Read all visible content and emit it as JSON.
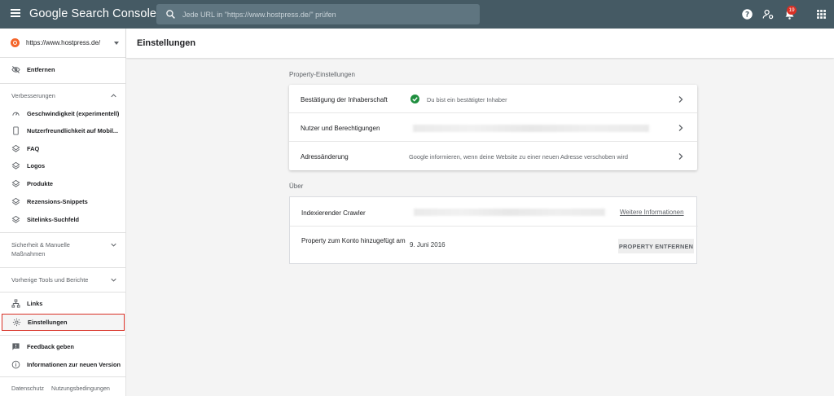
{
  "app": {
    "title": "Google Search Console"
  },
  "search": {
    "placeholder": "Jede URL in \"https://www.hostpress.de/\" prüfen"
  },
  "topbar": {
    "notification_count": "19"
  },
  "sidebar": {
    "property": "https://www.hostpress.de/",
    "remove_item": "Entfernen",
    "sections": {
      "improvements": "Verbesserungen",
      "security": "Sicherheit & Manuelle Maßnahmen",
      "legacy": "Vorherige Tools und Berichte"
    },
    "improvement_items": [
      {
        "label": "Geschwindigkeit (experimentell)",
        "icon": "speed-icon"
      },
      {
        "label": "Nutzerfreundlichkeit auf Mobil...",
        "icon": "mobile-icon"
      },
      {
        "label": "FAQ",
        "icon": "layers-icon"
      },
      {
        "label": "Logos",
        "icon": "layers-icon"
      },
      {
        "label": "Produkte",
        "icon": "layers-icon"
      },
      {
        "label": "Rezensions-Snippets",
        "icon": "layers-icon"
      },
      {
        "label": "Sitelinks-Suchfeld",
        "icon": "layers-icon"
      }
    ],
    "links": "Links",
    "settings": "Einstellungen",
    "feedback": "Feedback geben",
    "new_version": "Informationen zur neuen Version",
    "footer": {
      "privacy": "Datenschutz",
      "terms": "Nutzungsbedingungen"
    }
  },
  "main": {
    "title": "Einstellungen",
    "property_settings": {
      "heading": "Property-Einstellungen",
      "rows": [
        {
          "label": "Bestätigung der Inhaberschaft",
          "value": "Du bist ein bestätigter Inhaber"
        },
        {
          "label": "Nutzer und Berechtigungen",
          "value": ""
        },
        {
          "label": "Adressänderung",
          "value": "Google informieren, wenn deine Website zu einer neuen Adresse verschoben wird"
        }
      ]
    },
    "about": {
      "heading": "Über",
      "crawler_label": "Indexierender Crawler",
      "crawler_link": "Weitere Informationen",
      "added_label": "Property zum Konto hinzugefügt am",
      "added_date": "9. Juni 2016",
      "remove_button": "PROPERTY ENTFERNEN"
    }
  },
  "colors": {
    "topbar": "#455a64",
    "verified": "#1e8e3e",
    "highlight_border": "#d93025",
    "property_icon": "#f4662b"
  }
}
